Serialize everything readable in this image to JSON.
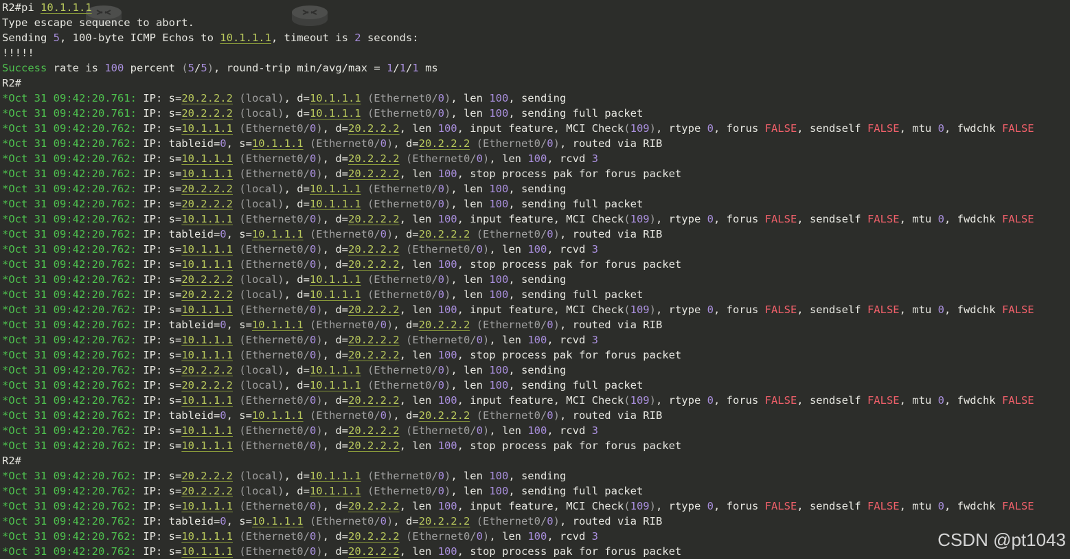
{
  "prompt_line": {
    "prompt": "R2#pi ",
    "target": "10.1.1.1"
  },
  "header_lines": [
    [
      [
        "t",
        "Type escape sequence to abort."
      ]
    ],
    [
      [
        "t",
        "Sending "
      ],
      [
        "n",
        "5"
      ],
      [
        "t",
        ", 100-byte ICMP Echos to "
      ],
      [
        "ip",
        "10.1.1.1"
      ],
      [
        "t",
        ", timeout is "
      ],
      [
        "n",
        "2"
      ],
      [
        "t",
        " seconds:"
      ]
    ],
    [
      [
        "t",
        "!!!!!"
      ]
    ],
    [
      [
        "g",
        "Success"
      ],
      [
        "t",
        " rate is "
      ],
      [
        "n",
        "100"
      ],
      [
        "t",
        " percent "
      ],
      [
        "p",
        "("
      ],
      [
        "n",
        "5"
      ],
      [
        "t",
        "/"
      ],
      [
        "n",
        "5"
      ],
      [
        "p",
        ")"
      ],
      [
        "t",
        ", round-trip min/avg/max = "
      ],
      [
        "n",
        "1"
      ],
      [
        "t",
        "/"
      ],
      [
        "n",
        "1"
      ],
      [
        "t",
        "/"
      ],
      [
        "n",
        "1"
      ],
      [
        "t",
        " ms"
      ]
    ],
    [
      [
        "t",
        "R2#"
      ]
    ]
  ],
  "log_prefix": "*Oct 31 ",
  "blocks": [
    {
      "ts": [
        "09:42:20.761",
        "09:42:20.761",
        "09:42:20.762",
        "09:42:20.762",
        "09:42:20.762",
        "09:42:20.762"
      ]
    },
    {
      "ts": [
        "09:42:20.762",
        "09:42:20.762",
        "09:42:20.762",
        "09:42:20.762",
        "09:42:20.762",
        "09:42:20.762"
      ]
    },
    {
      "ts": [
        "09:42:20.762",
        "09:42:20.762",
        "09:42:20.762",
        "09:42:20.762",
        "09:42:20.762",
        "09:42:20.762"
      ]
    },
    {
      "ts": [
        "09:42:20.762",
        "09:42:20.762",
        "09:42:20.762",
        "09:42:20.762",
        "09:42:20.762",
        "09:42:20.762"
      ]
    },
    {
      "prompt_before": "R2#",
      "ts": [
        "09:42:20.762",
        "09:42:20.762",
        "09:42:20.762",
        "09:42:20.762",
        "09:42:20.762",
        "09:42:20.762"
      ]
    }
  ],
  "templates": [
    [
      [
        "t",
        "IP: s="
      ],
      [
        "ip",
        "20.2.2.2"
      ],
      [
        "t",
        " "
      ],
      [
        "p",
        "(local)"
      ],
      [
        "t",
        ", d="
      ],
      [
        "ip",
        "10.1.1.1"
      ],
      [
        "t",
        " "
      ],
      [
        "p",
        "(Ethernet0/"
      ],
      [
        "n",
        "0"
      ],
      [
        "p",
        ")"
      ],
      [
        "t",
        ", len "
      ],
      [
        "n",
        "100"
      ],
      [
        "t",
        ", sending"
      ]
    ],
    [
      [
        "t",
        "IP: s="
      ],
      [
        "ip",
        "20.2.2.2"
      ],
      [
        "t",
        " "
      ],
      [
        "p",
        "(local)"
      ],
      [
        "t",
        ", d="
      ],
      [
        "ip",
        "10.1.1.1"
      ],
      [
        "t",
        " "
      ],
      [
        "p",
        "(Ethernet0/"
      ],
      [
        "n",
        "0"
      ],
      [
        "p",
        ")"
      ],
      [
        "t",
        ", len "
      ],
      [
        "n",
        "100"
      ],
      [
        "t",
        ", sending full packet"
      ]
    ],
    [
      [
        "t",
        "IP: s="
      ],
      [
        "ip",
        "10.1.1.1"
      ],
      [
        "t",
        " "
      ],
      [
        "p",
        "(Ethernet0/"
      ],
      [
        "n",
        "0"
      ],
      [
        "p",
        ")"
      ],
      [
        "t",
        ", d="
      ],
      [
        "ip",
        "20.2.2.2"
      ],
      [
        "t",
        ", len "
      ],
      [
        "n",
        "100"
      ],
      [
        "t",
        ", input feature, MCI Check"
      ],
      [
        "p",
        "("
      ],
      [
        "n",
        "109"
      ],
      [
        "p",
        ")"
      ],
      [
        "t",
        ", rtype "
      ],
      [
        "n",
        "0"
      ],
      [
        "t",
        ", forus "
      ],
      [
        "r",
        "FALSE"
      ],
      [
        "t",
        ", sendself "
      ],
      [
        "r",
        "FALSE"
      ],
      [
        "t",
        ", mtu "
      ],
      [
        "n",
        "0"
      ],
      [
        "t",
        ", fwdchk "
      ],
      [
        "r",
        "FALSE"
      ]
    ],
    [
      [
        "t",
        "IP: tableid="
      ],
      [
        "n",
        "0"
      ],
      [
        "t",
        ", s="
      ],
      [
        "ip",
        "10.1.1.1"
      ],
      [
        "t",
        " "
      ],
      [
        "p",
        "(Ethernet0/"
      ],
      [
        "n",
        "0"
      ],
      [
        "p",
        ")"
      ],
      [
        "t",
        ", d="
      ],
      [
        "ip",
        "20.2.2.2"
      ],
      [
        "t",
        " "
      ],
      [
        "p",
        "(Ethernet0/"
      ],
      [
        "n",
        "0"
      ],
      [
        "p",
        ")"
      ],
      [
        "t",
        ", routed via RIB"
      ]
    ],
    [
      [
        "t",
        "IP: s="
      ],
      [
        "ip",
        "10.1.1.1"
      ],
      [
        "t",
        " "
      ],
      [
        "p",
        "(Ethernet0/"
      ],
      [
        "n",
        "0"
      ],
      [
        "p",
        ")"
      ],
      [
        "t",
        ", d="
      ],
      [
        "ip",
        "20.2.2.2"
      ],
      [
        "t",
        " "
      ],
      [
        "p",
        "(Ethernet0/"
      ],
      [
        "n",
        "0"
      ],
      [
        "p",
        ")"
      ],
      [
        "t",
        ", len "
      ],
      [
        "n",
        "100"
      ],
      [
        "t",
        ", rcvd "
      ],
      [
        "n",
        "3"
      ]
    ],
    [
      [
        "t",
        "IP: s="
      ],
      [
        "ip",
        "10.1.1.1"
      ],
      [
        "t",
        " "
      ],
      [
        "p",
        "(Ethernet0/"
      ],
      [
        "n",
        "0"
      ],
      [
        "p",
        ")"
      ],
      [
        "t",
        ", d="
      ],
      [
        "ip",
        "20.2.2.2"
      ],
      [
        "t",
        ", len "
      ],
      [
        "n",
        "100"
      ],
      [
        "t",
        ", stop process pak for forus packet"
      ]
    ]
  ],
  "watermark": "CSDN @pt1043",
  "colors": {
    "background": "#2c2d2a",
    "green": "#4ec04e",
    "ip": "#b9c95c",
    "number": "#a98fdd",
    "false": "#f0606a"
  },
  "icons": [
    "router-icon",
    "router-icon"
  ]
}
